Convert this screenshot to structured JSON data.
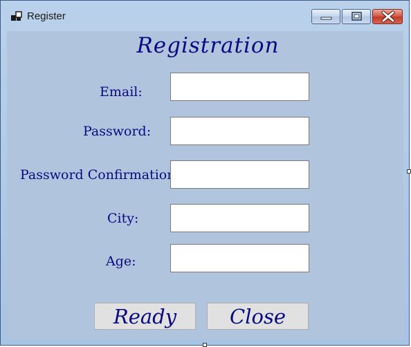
{
  "window": {
    "title": "Register"
  },
  "form": {
    "heading": "Registration",
    "fields": [
      {
        "label": "Email:",
        "value": ""
      },
      {
        "label": "Password:",
        "value": ""
      },
      {
        "label": "Password Confirmation:",
        "value": ""
      },
      {
        "label": "City:",
        "value": ""
      },
      {
        "label": "Age:",
        "value": ""
      }
    ]
  },
  "buttons": {
    "ready_label": "Ready",
    "close_label": "Close"
  },
  "colors": {
    "client_background": "#b0c4de",
    "text_navy": "#0a0a80",
    "close_button_red": "#c03a26"
  },
  "icons": {
    "app_icon": "windows-form-icon",
    "minimize": "minimize-icon",
    "maximize": "maximize-icon",
    "close": "close-icon"
  }
}
